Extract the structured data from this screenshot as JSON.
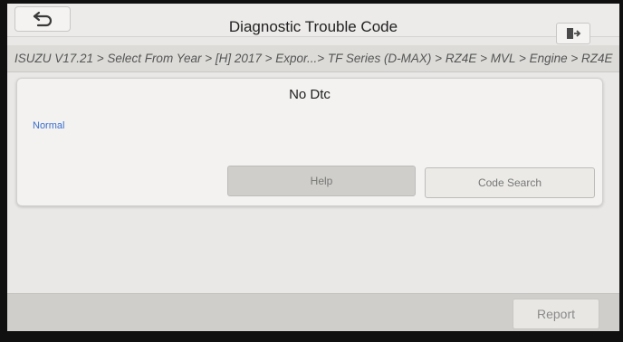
{
  "header": {
    "title": "Diagnostic Trouble Code",
    "back_icon": "back-arrow-icon",
    "exit_icon": "exit-icon"
  },
  "breadcrumb": {
    "path": "ISUZU V17.21 > Select From Year > [H] 2017 > Expor...> TF Series (D-MAX) > RZ4E > MVL > Engine > RZ4E"
  },
  "result": {
    "message": "No Dtc",
    "status": "Normal"
  },
  "actions": {
    "help_label": "Help",
    "code_search_label": "Code Search",
    "report_label": "Report"
  },
  "colors": {
    "status_text": "#3b6fd1",
    "background": "#e9e8e6"
  }
}
